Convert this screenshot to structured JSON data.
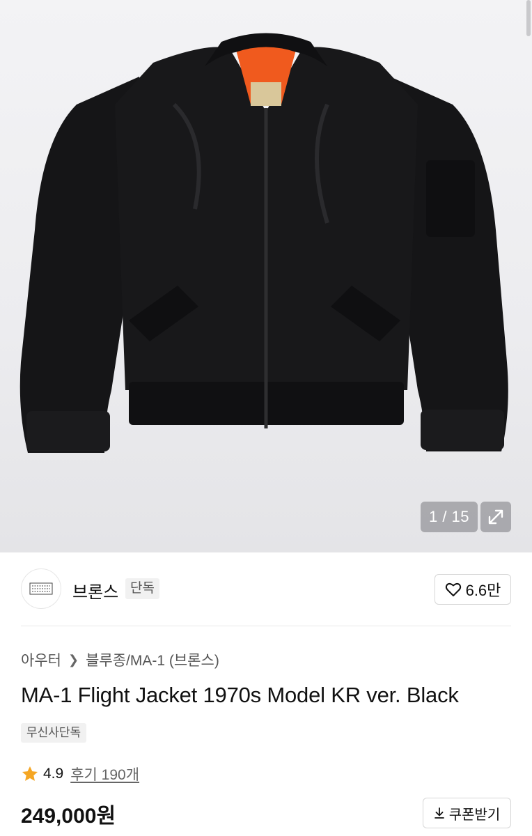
{
  "gallery": {
    "counter": "1 / 15",
    "expand_icon": "expand-icon"
  },
  "brand": {
    "name": "브론스",
    "tag": "단독",
    "logo_icon": "brand-logo"
  },
  "like": {
    "count": "6.6만",
    "icon": "heart-icon"
  },
  "breadcrumb": {
    "category": "아우터",
    "subcategory": "블루종/MA-1 (브론스)"
  },
  "product": {
    "title": "MA-1 Flight Jacket 1970s Model KR ver. Black",
    "exclusive_badge": "무신사단독",
    "rating": "4.9",
    "reviews": "후기 190개",
    "price": "249,000원"
  },
  "coupon": {
    "label": "쿠폰받기",
    "icon": "download-icon"
  },
  "colors": {
    "star": "#f5a623",
    "jacket": "#141416",
    "lining": "#f05a1e"
  }
}
